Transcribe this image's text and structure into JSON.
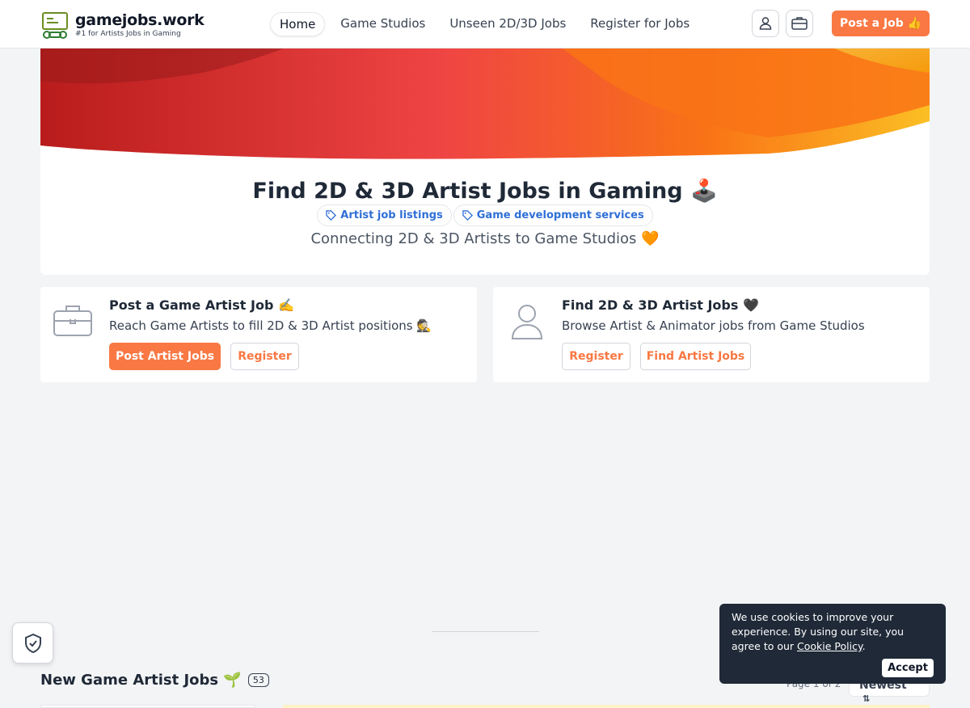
{
  "brand": {
    "name": "gamejobs.work",
    "tagline": "#1 for Artists Jobs in Gaming"
  },
  "nav": {
    "items": [
      "Home",
      "Game Studios",
      "Unseen 2D/3D Jobs",
      "Register for Jobs"
    ],
    "active": "Home"
  },
  "header": {
    "post_job_label": "Post a Job 👍",
    "icons": [
      "user-icon",
      "briefcase-icon"
    ]
  },
  "hero": {
    "title": "Find 2D & 3D Artist Jobs in Gaming 🕹️",
    "chips": [
      "Artist job listings",
      "Game development services"
    ],
    "subtitle": "Connecting 2D & 3D Artists to Game Studios 🧡"
  },
  "cards": {
    "employer": {
      "title": "Post a Game Artist Job ✍️",
      "desc": "Reach Game Artists to fill 2D & 3D Artist positions 🕵️",
      "primary": "Post Artist Jobs",
      "secondary": "Register"
    },
    "artist": {
      "title": "Find 2D & 3D Artist Jobs 🖤",
      "desc": "Browse Artist & Animator jobs from Game Studios",
      "primary": "Register",
      "secondary": "Find Artist Jobs"
    }
  },
  "jobs": {
    "title": "New Game Artist Jobs 🌱",
    "count": "53",
    "page": "Page 1 of 2",
    "sort": "Newest"
  },
  "cookie": {
    "text": "We use cookies to improve your experience. By using our site, you agree to our",
    "link": "Cookie Policy",
    "accept": "Accept"
  },
  "colors": {
    "accent": "#f97843",
    "chip_text": "#2f6fd6",
    "banner_orange": "#f97316",
    "banner_red": "#dc2626"
  }
}
